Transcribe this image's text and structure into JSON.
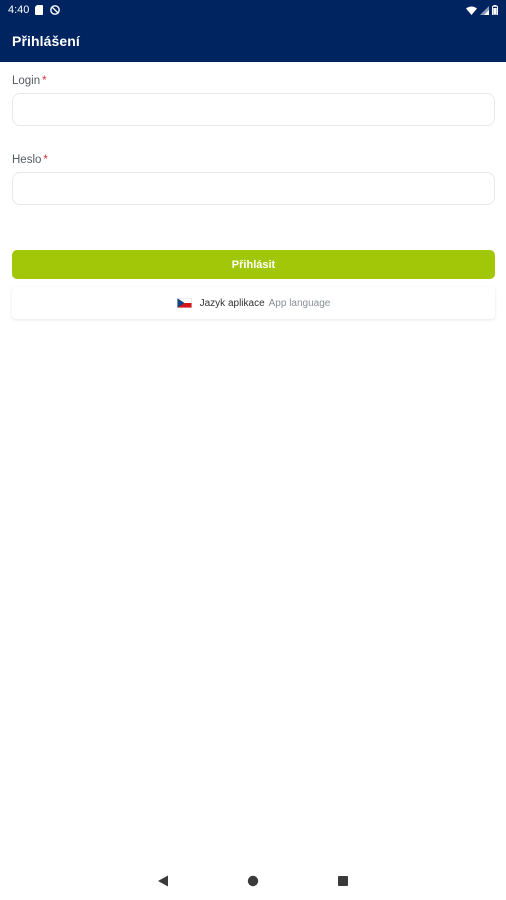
{
  "status_bar": {
    "time": "4:40",
    "left_icons": [
      "sim-card-icon",
      "blocked-notification-icon"
    ],
    "right_icons": [
      "wifi-icon",
      "signal-icon",
      "battery-icon"
    ]
  },
  "app_bar": {
    "title": "Přihlášení"
  },
  "form": {
    "login": {
      "label": "Login",
      "required_mark": "*",
      "value": "",
      "placeholder": ""
    },
    "password": {
      "label": "Heslo",
      "required_mark": "*",
      "value": "",
      "placeholder": ""
    },
    "submit_label": "Přihlásit"
  },
  "language": {
    "flag_icon": "czech-flag-icon",
    "primary_label": "Jazyk aplikace",
    "secondary_label": "App language"
  },
  "nav_bar": {
    "icons": [
      "back-icon",
      "home-icon",
      "recents-icon"
    ]
  },
  "colors": {
    "header": "#00245f",
    "accent": "#a2c708",
    "required": "#d33131"
  }
}
